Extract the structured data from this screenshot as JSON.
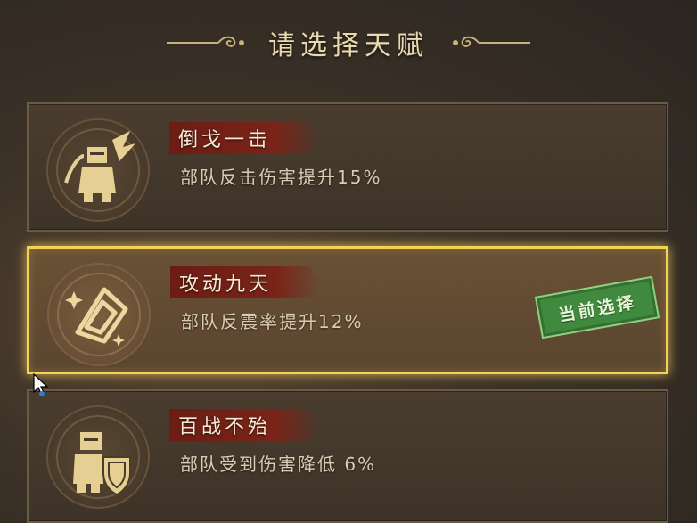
{
  "header": {
    "title": "请选择天赋"
  },
  "talents": [
    {
      "name": "倒戈一击",
      "description": "部队反击伤害提升15%",
      "selected": false,
      "icon": "knight-counter-icon"
    },
    {
      "name": "攻动九天",
      "description": "部队反震率提升12%",
      "selected": true,
      "icon": "spiral-shield-icon"
    },
    {
      "name": "百战不殆",
      "description": "部队受到伤害降低 6%",
      "selected": false,
      "icon": "knight-shield-icon"
    }
  ],
  "current_selection_label": "当前选择",
  "colors": {
    "gold": "#f2d35a",
    "title_text": "#ead9ae",
    "name_banner": "#7a2418",
    "stamp_green": "#3f8a3e"
  }
}
